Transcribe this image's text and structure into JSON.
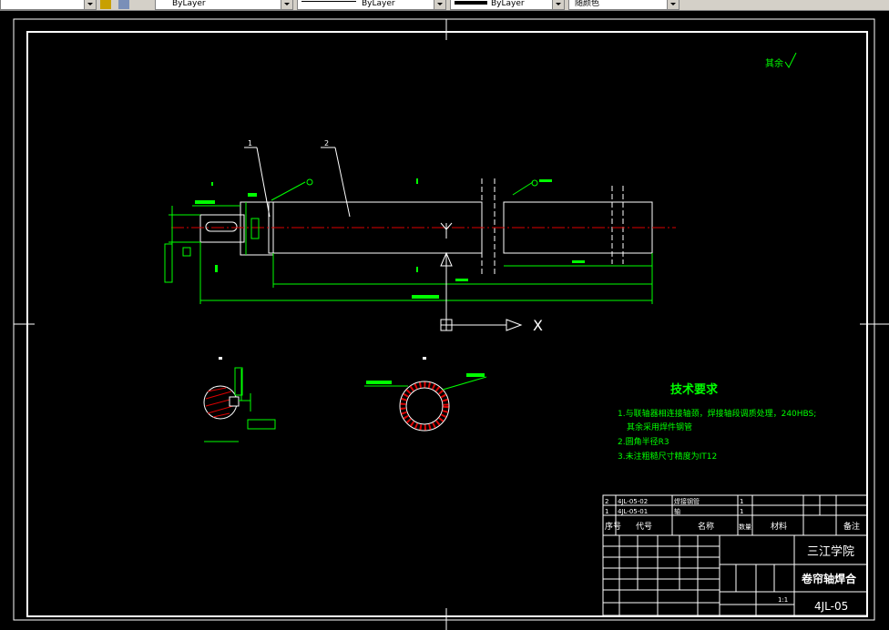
{
  "toolbar": {
    "layer_color": "ByLayer",
    "linetype": "ByLayer",
    "lineweight": "ByLayer",
    "plot_style": "随颜色"
  },
  "drawing": {
    "roughness_note": "其余",
    "part_number_1": "1",
    "part_number_2": "2",
    "section_label": "Y",
    "ucs_x_label": "X",
    "tech_req_title": "技术要求",
    "tech_req_1a": "1.与联轴器相连接轴颈，焊接轴段调质处理，240HBS;",
    "tech_req_1b": "其余采用焊件钢管",
    "tech_req_2": "2.圆角半径R3",
    "tech_req_3": "3.未注粗糙尺寸精度为IT12"
  },
  "title_block": {
    "school": "三江学院",
    "part_name": "卷帘轴焊合",
    "drawing_no": "4JL-05",
    "scale": "1:1",
    "header_seq": "序号",
    "header_code": "代号",
    "header_name": "名称",
    "header_qty": "数量",
    "header_material": "材料",
    "header_remark": "备注",
    "row2_seq": "2",
    "row2_code": "4JL-05-02",
    "row2_name": "焊接钢管",
    "row2_qty": "1",
    "row1_seq": "1",
    "row1_code": "4JL-05-01",
    "row1_name": "轴",
    "row1_qty": "1"
  }
}
